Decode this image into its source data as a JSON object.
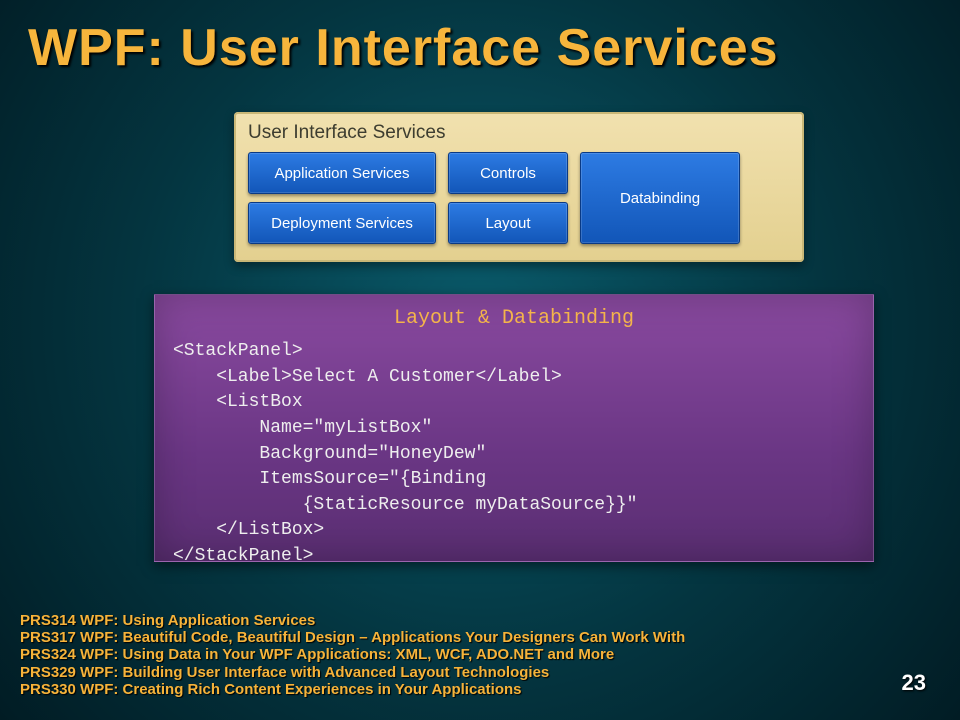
{
  "title": "WPF: User Interface Services",
  "panel": {
    "heading": "User Interface Services",
    "col1": [
      "Application Services",
      "Deployment Services"
    ],
    "col2": [
      "Controls",
      "Layout"
    ],
    "tall": "Databinding"
  },
  "code": {
    "heading": "Layout & Databinding",
    "body": "<StackPanel>\n    <Label>Select A Customer</Label>\n    <ListBox\n        Name=\"myListBox\"\n        Background=\"HoneyDew\"\n        ItemsSource=\"{Binding\n            {StaticResource myDataSource}}\"\n    </ListBox>\n</StackPanel>"
  },
  "references": [
    "PRS314 WPF: Using Application Services",
    "PRS317 WPF: Beautiful Code, Beautiful Design – Applications Your Designers Can Work With",
    "PRS324 WPF: Using Data in Your WPF Applications: XML, WCF, ADO.NET and More",
    "PRS329 WPF: Building User Interface with Advanced Layout Technologies",
    "PRS330 WPF: Creating Rich Content Experiences in Your Applications"
  ],
  "page_number": "23"
}
